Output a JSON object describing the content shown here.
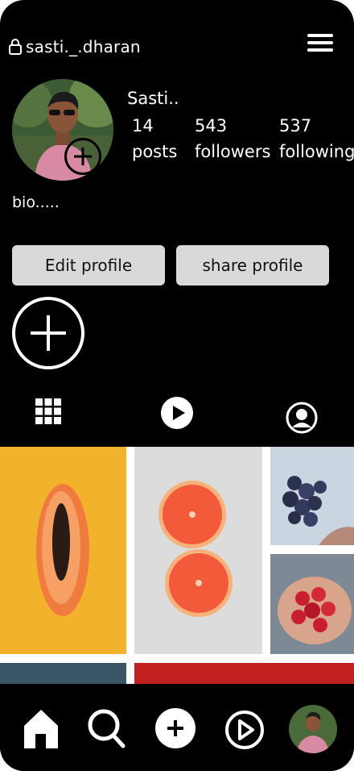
{
  "header": {
    "username": "sasti._.dharan"
  },
  "profile": {
    "display_name": "Sasti..",
    "stats": [
      {
        "num": "14",
        "label": "posts"
      },
      {
        "num": "543",
        "label": "followers"
      },
      {
        "num": "537",
        "label": "following"
      }
    ],
    "bio": "bio....."
  },
  "buttons": {
    "edit": "Edit profile",
    "share": "share profile"
  },
  "tabs": [
    "grid-icon",
    "reels-play-icon",
    "tagged-user-icon"
  ],
  "grid": [
    "papaya",
    "grapefruit",
    "grapes",
    "strawberries",
    "pineapple",
    "watermelon"
  ],
  "nav": [
    "home-icon",
    "search-icon",
    "create-icon",
    "reels-icon",
    "profile-avatar"
  ],
  "colors": {
    "background": "#000000",
    "button": "#d9d9d9",
    "text": "#ffffff"
  }
}
